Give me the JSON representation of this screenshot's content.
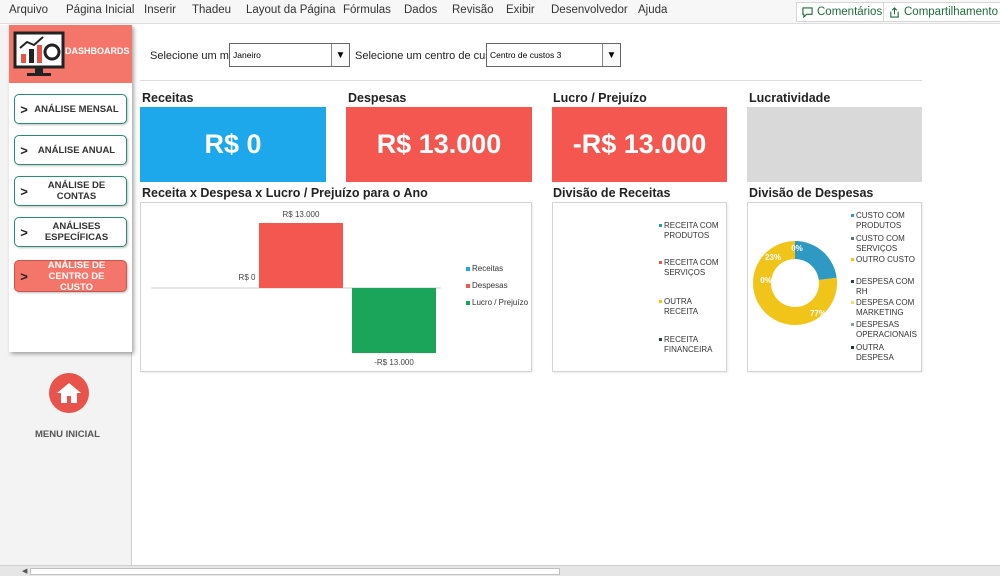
{
  "ribbon": {
    "tabs": [
      "Arquivo",
      "Página Inicial",
      "Inserir",
      "Thadeu",
      "Layout da Página",
      "Fórmulas",
      "Dados",
      "Revisão",
      "Exibir",
      "Desenvolvedor",
      "Ajuda"
    ],
    "comments_label": "Comentários",
    "share_label": "Compartilhamento"
  },
  "sidebar": {
    "header_label": "DASHBOARDS",
    "items": [
      {
        "label": "ANÁLISE MENSAL",
        "active": false
      },
      {
        "label": "ANÁLISE ANUAL",
        "active": false
      },
      {
        "label": "ANÁLISE DE CONTAS",
        "active": false
      },
      {
        "label": "ANÁLISES ESPECÍFICAS",
        "active": false
      },
      {
        "label": "ANÁLISE DE CENTRO DE CUSTO",
        "active": true
      }
    ],
    "home_label": "MENU INICIAL"
  },
  "filters": {
    "month_label": "Selecione um mês:",
    "month_value": "Janeiro",
    "cost_center_label": "Selecione um centro de custo:",
    "cost_center_value": "Centro de custos 3"
  },
  "kpis": [
    {
      "title": "Receitas",
      "value": "R$ 0",
      "color": "#1ea8ec"
    },
    {
      "title": "Despesas",
      "value": "R$ 13.000",
      "color": "#f4574f"
    },
    {
      "title": "Lucro / Prejuízo",
      "value": "-R$ 13.000",
      "color": "#f4574f"
    },
    {
      "title": "Lucratividade",
      "value": "",
      "color": "#d9d9d9"
    }
  ],
  "panels": {
    "bar_title": "Receita x Despesa x Lucro / Prejuízo para o Ano",
    "income_title": "Divisão de Receitas",
    "expense_title": "Divisão de Despesas"
  },
  "chart_data": [
    {
      "type": "bar",
      "categories": [
        "Receitas",
        "Despesas",
        "Lucro / Prejuízo"
      ],
      "values": [
        0,
        13000,
        -13000
      ],
      "data_labels": [
        "R$ 0",
        "R$ 13.000",
        "-R$ 13.000"
      ],
      "colors": [
        "#1ea8ec",
        "#f4574f",
        "#1aa55a"
      ],
      "legend": [
        "Receitas",
        "Despesas",
        "Lucro / Prejuízo"
      ],
      "legend_placement": "right"
    },
    {
      "type": "pie",
      "legend": [
        "RECEITA COM PRODUTOS",
        "RECEITA COM SERVIÇOS",
        "OUTRA RECEITA",
        "RECEITA FINANCEIRA"
      ],
      "colors": [
        "#2aa198",
        "#e8534c",
        "#f0c419",
        "#2d3e50"
      ],
      "values": []
    },
    {
      "type": "pie",
      "legend": [
        "CUSTO COM PRODUTOS",
        "CUSTO COM SERVIÇOS",
        "OUTRO CUSTO",
        "DESPESA COM RH",
        "DESPESA COM MARKETING",
        "DESPESAS OPERACIONAIS",
        "OUTRA DESPESA"
      ],
      "colors": [
        "#2e9ac4",
        "#5b7080",
        "#f0c419",
        "#2d3e50",
        "#f7dc6f",
        "#8e9ea8",
        "#1f2f3d"
      ],
      "slices": [
        {
          "label": "23%",
          "value": 23,
          "color": "#2e9ac4"
        },
        {
          "label": "0%",
          "value": 0,
          "color": "#5b7080"
        },
        {
          "label": "77%",
          "value": 77,
          "color": "#f0c419"
        },
        {
          "label": "0%",
          "value": 0,
          "color": "#2d3e50"
        }
      ]
    }
  ]
}
